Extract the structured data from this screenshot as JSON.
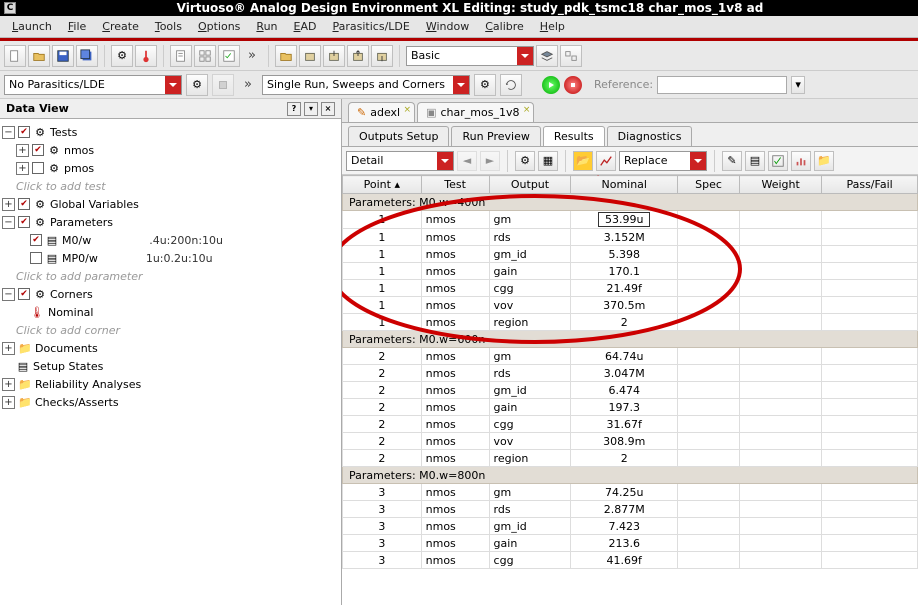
{
  "window_title": "Virtuoso® Analog Design Environment XL Editing: study_pdk_tsmc18 char_mos_1v8 ad",
  "menus": [
    "Launch",
    "File",
    "Create",
    "Tools",
    "Options",
    "Run",
    "EAD",
    "Parasitics/LDE",
    "Window",
    "Calibre",
    "Help"
  ],
  "parasitics_combo": "No Parasitics/LDE",
  "runmode_combo": "Single Run, Sweeps and Corners",
  "basic_combo": "Basic",
  "reference_label": "Reference:",
  "data_view_title": "Data View",
  "tree": {
    "tests": "Tests",
    "nmos": "nmos",
    "pmos": "pmos",
    "add_test": "Click to add test",
    "gv": "Global Variables",
    "params": "Parameters",
    "p1_name": "M0/w",
    "p1_val": ".4u:200n:10u",
    "p2_name": "MP0/w",
    "p2_val": "1u:0.2u:10u",
    "add_param": "Click to add parameter",
    "corners": "Corners",
    "nominal": "Nominal",
    "add_corner": "Click to add corner",
    "docs": "Documents",
    "setup": "Setup States",
    "rel": "Reliability Analyses",
    "chkasrt": "Checks/Asserts"
  },
  "main_tabs": [
    {
      "label": "adexl"
    },
    {
      "label": "char_mos_1v8"
    }
  ],
  "sub_tabs": [
    "Outputs Setup",
    "Run Preview",
    "Results",
    "Diagnostics"
  ],
  "sub_tab_active": 2,
  "detail_combo": "Detail",
  "replace_combo": "Replace",
  "columns": [
    "Point",
    "Test",
    "Output",
    "Nominal",
    "Spec",
    "Weight",
    "Pass/Fail"
  ],
  "groups": [
    {
      "header": "Parameters: M0.w=400n",
      "rows": [
        {
          "p": "1",
          "t": "nmos",
          "o": "gm",
          "n": "53.99u",
          "box": true
        },
        {
          "p": "1",
          "t": "nmos",
          "o": "rds",
          "n": "3.152M"
        },
        {
          "p": "1",
          "t": "nmos",
          "o": "gm_id",
          "n": "5.398"
        },
        {
          "p": "1",
          "t": "nmos",
          "o": "gain",
          "n": "170.1"
        },
        {
          "p": "1",
          "t": "nmos",
          "o": "cgg",
          "n": "21.49f"
        },
        {
          "p": "1",
          "t": "nmos",
          "o": "vov",
          "n": "370.5m"
        },
        {
          "p": "1",
          "t": "nmos",
          "o": "region",
          "n": "2"
        }
      ]
    },
    {
      "header": "Parameters: M0.w=600n",
      "rows": [
        {
          "p": "2",
          "t": "nmos",
          "o": "gm",
          "n": "64.74u"
        },
        {
          "p": "2",
          "t": "nmos",
          "o": "rds",
          "n": "3.047M"
        },
        {
          "p": "2",
          "t": "nmos",
          "o": "gm_id",
          "n": "6.474"
        },
        {
          "p": "2",
          "t": "nmos",
          "o": "gain",
          "n": "197.3"
        },
        {
          "p": "2",
          "t": "nmos",
          "o": "cgg",
          "n": "31.67f"
        },
        {
          "p": "2",
          "t": "nmos",
          "o": "vov",
          "n": "308.9m"
        },
        {
          "p": "2",
          "t": "nmos",
          "o": "region",
          "n": "2"
        }
      ]
    },
    {
      "header": "Parameters: M0.w=800n",
      "rows": [
        {
          "p": "3",
          "t": "nmos",
          "o": "gm",
          "n": "74.25u"
        },
        {
          "p": "3",
          "t": "nmos",
          "o": "rds",
          "n": "2.877M"
        },
        {
          "p": "3",
          "t": "nmos",
          "o": "gm_id",
          "n": "7.423"
        },
        {
          "p": "3",
          "t": "nmos",
          "o": "gain",
          "n": "213.6"
        },
        {
          "p": "3",
          "t": "nmos",
          "o": "cgg",
          "n": "41.69f"
        }
      ]
    }
  ]
}
